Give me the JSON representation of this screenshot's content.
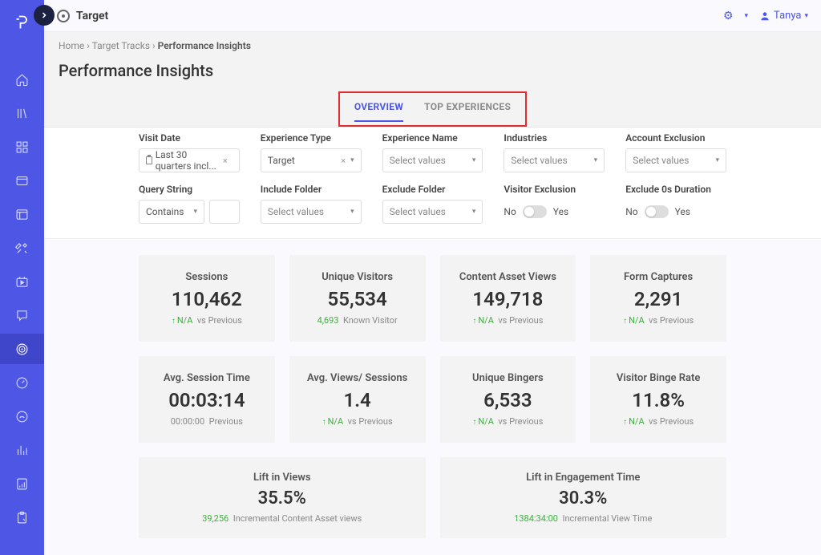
{
  "app": {
    "name": "Target"
  },
  "user": {
    "name": "Tanya"
  },
  "breadcrumb": {
    "a": "Home",
    "b": "Target Tracks",
    "c": "Performance Insights"
  },
  "page": {
    "title": "Performance Insights"
  },
  "tabs": {
    "overview": "OVERVIEW",
    "top": "TOP EXPERIENCES"
  },
  "filters": {
    "visit_date": {
      "label": "Visit Date",
      "value": "Last 30 quarters incl..."
    },
    "experience_type": {
      "label": "Experience Type",
      "value": "Target"
    },
    "experience_name": {
      "label": "Experience Name",
      "placeholder": "Select values"
    },
    "industries": {
      "label": "Industries",
      "placeholder": "Select values"
    },
    "account_exclusion": {
      "label": "Account Exclusion",
      "placeholder": "Select values"
    },
    "query_string": {
      "label": "Query String",
      "op": "Contains"
    },
    "include_folder": {
      "label": "Include Folder",
      "placeholder": "Select values"
    },
    "exclude_folder": {
      "label": "Exclude Folder",
      "placeholder": "Select values"
    },
    "visitor_exclusion": {
      "label": "Visitor Exclusion",
      "no": "No",
      "yes": "Yes"
    },
    "exclude_zero": {
      "label": "Exclude 0s Duration",
      "no": "No",
      "yes": "Yes"
    }
  },
  "kpis": {
    "sessions": {
      "title": "Sessions",
      "value": "110,462",
      "change": "N/A",
      "vs": "vs Previous"
    },
    "visitors": {
      "title": "Unique Visitors",
      "value": "55,534",
      "known_n": "4,693",
      "known_l": "Known Visitor"
    },
    "asset": {
      "title": "Content Asset Views",
      "value": "149,718",
      "change": "N/A",
      "vs": "vs Previous"
    },
    "form": {
      "title": "Form Captures",
      "value": "2,291",
      "change": "N/A",
      "vs": "vs Previous"
    },
    "avg_sess": {
      "title": "Avg. Session Time",
      "value": "00:03:14",
      "base": "00:00:00",
      "vs": "Previous"
    },
    "avg_views": {
      "title": "Avg. Views/ Sessions",
      "value": "1.4",
      "change": "N/A",
      "vs": "vs Previous"
    },
    "bingers": {
      "title": "Unique Bingers",
      "value": "6,533",
      "change": "N/A",
      "vs": "vs Previous"
    },
    "binge_rate": {
      "title": "Visitor Binge Rate",
      "value": "11.8%",
      "change": "N/A",
      "vs": "vs Previous"
    },
    "lift_views": {
      "title": "Lift in Views",
      "value": "35.5%",
      "n": "39,256",
      "l": "Incremental Content Asset views"
    },
    "lift_eng": {
      "title": "Lift in Engagement Time",
      "value": "30.3%",
      "n": "1384:34:00",
      "l": "Incremental View Time"
    }
  }
}
